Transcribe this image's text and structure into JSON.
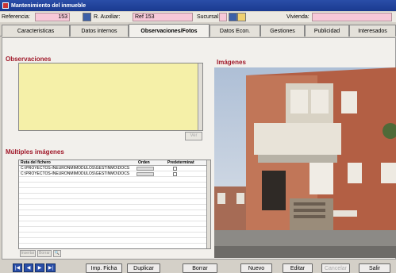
{
  "window": {
    "title": "Mantenimiento del inmueble"
  },
  "header": {
    "referencia_label": "Referencia:",
    "referencia_value": "153",
    "aux_label": "R. Auxiliar:",
    "aux_value": "Ref 153",
    "sucursal_label": "Sucursal:",
    "vivienda_label": "Vivienda:"
  },
  "tabs": [
    {
      "label": "Caracteristicas"
    },
    {
      "label": "Datos internos"
    },
    {
      "label": "Observaciones/Fotos"
    },
    {
      "label": "Datos Econ."
    },
    {
      "label": "Gestiones"
    },
    {
      "label": "Publicidad"
    },
    {
      "label": "Interesados"
    }
  ],
  "observaciones": {
    "title": "Observaciones",
    "ver_button": "Ver"
  },
  "imagenes": {
    "title": "Imágenes"
  },
  "multiples": {
    "title": "Múltiples imágenes",
    "columns": [
      "Ruta del fichero",
      "Orden",
      "Predeterminat"
    ],
    "rows": [
      {
        "path": "C:\\PROYECTOS-INEURONMIMODULOS\\GESTINMO\\DOCS"
      },
      {
        "path": "C:\\PROYECTOS-INEURONMIMODULOS\\GESTINMO\\DOCS"
      }
    ],
    "insertar_label": "Insertar",
    "borrar_label": "Borrar"
  },
  "bottom": {
    "imp_ficha": "Imp. Ficha",
    "duplicar": "Duplicar",
    "borrar": "Borrar",
    "nuevo": "Nuevo",
    "editar": "Editar",
    "cancelar": "Cancelar",
    "salir": "Salir"
  }
}
